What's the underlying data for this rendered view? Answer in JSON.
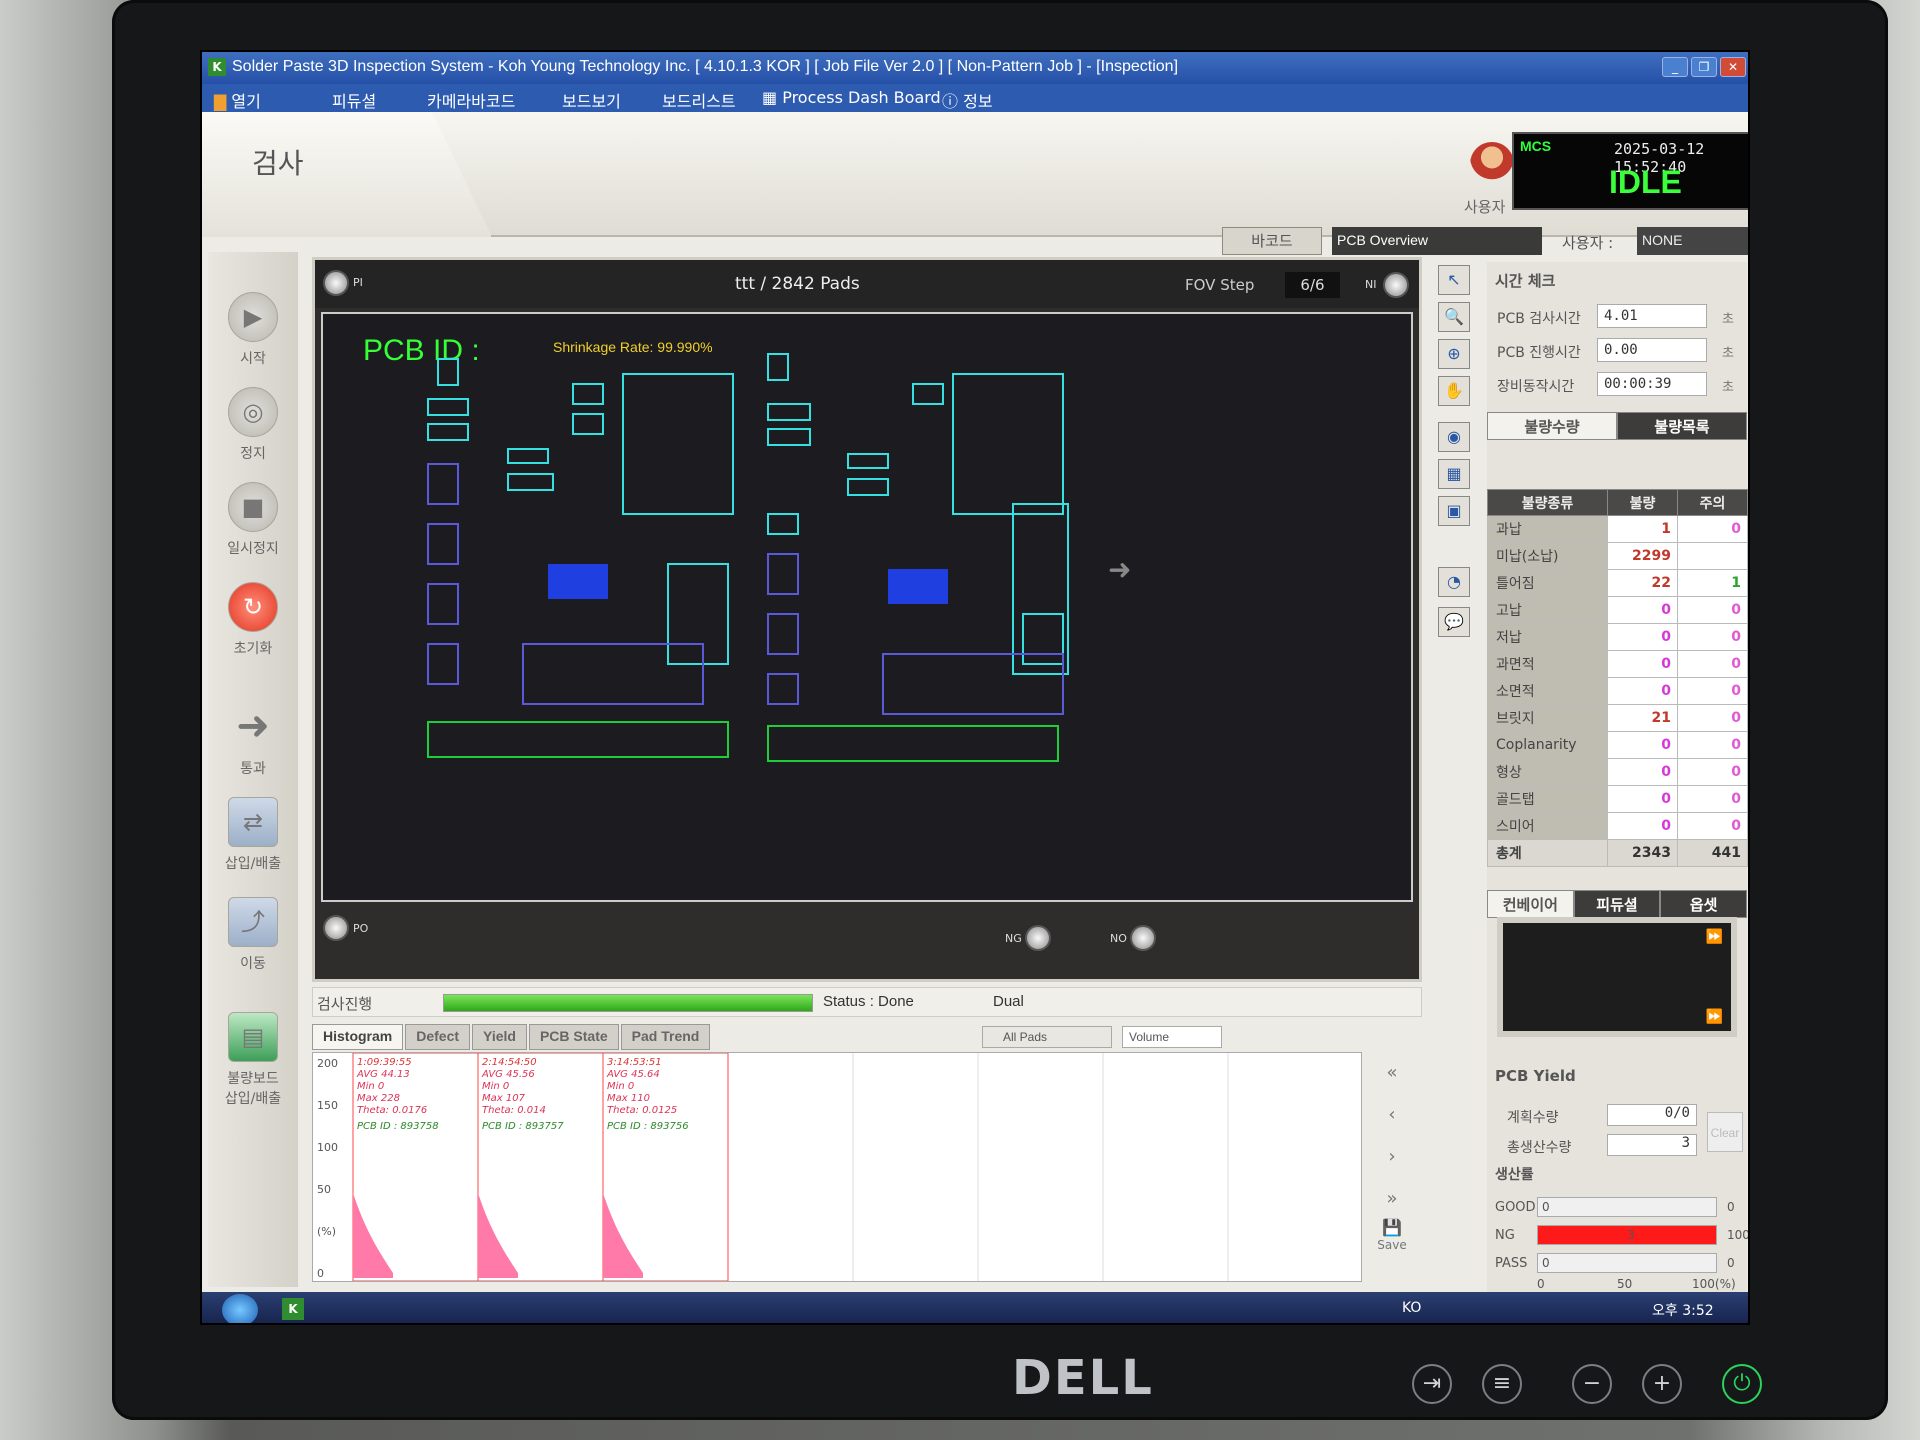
{
  "window": {
    "title": "Solder Paste 3D Inspection System - Koh Young Technology Inc. [ 4.10.1.3 KOR ] [ Job File Ver 2.0 ] [ Non-Pattern Job ] - [Inspection]"
  },
  "menu": [
    "열기",
    "피듀셜",
    "카메라바코드",
    "보드보기",
    "보드리스트",
    "Process Dash Board",
    "정보"
  ],
  "tab": {
    "label": "검사"
  },
  "user": {
    "label": "사용자"
  },
  "mcs": {
    "tag": "MCS",
    "datetime": "2025-03-12  15:52:40",
    "status": "IDLE"
  },
  "header": {
    "barcode": "바코드",
    "overview": "PCB Overview",
    "user_label": "사용자 :",
    "user_value": "NONE"
  },
  "toolbar": [
    {
      "label": "시작",
      "icon": "play-icon"
    },
    {
      "label": "정지",
      "icon": "stop-icon"
    },
    {
      "label": "일시정지",
      "icon": "pause-icon"
    },
    {
      "label": "초기화",
      "icon": "reset-icon"
    },
    {
      "label": "통과",
      "icon": "pass-arrow-icon"
    },
    {
      "label": "삽입/배출",
      "icon": "insert-eject-icon"
    },
    {
      "label": "이동",
      "icon": "move-icon"
    },
    {
      "label": "불량보드\n삽입/배출",
      "icon": "ng-board-icon"
    }
  ],
  "viewer": {
    "title": "ttt / 2842 Pads",
    "fov_label": "FOV Step",
    "fov_value": "6/6",
    "pcb_id": "PCB ID :",
    "shrink": "Shrinkage Rate: 99.990%",
    "knobs": {
      "pi": "PI",
      "ni": "NI",
      "po": "PO",
      "ng": "NG",
      "no": "NO"
    }
  },
  "timecheck": {
    "title": "시간 체크",
    "rows": [
      {
        "label": "PCB 검사시간",
        "value": "4.01",
        "unit": "초"
      },
      {
        "label": "PCB 진행시간",
        "value": "0.00",
        "unit": "초"
      },
      {
        "label": "장비동작시간",
        "value": "00:00:39",
        "unit": "초"
      }
    ]
  },
  "defect_tabs": [
    "불량수량",
    "불량목록"
  ],
  "defect_table": {
    "headers": [
      "불량종류",
      "불량",
      "주의"
    ],
    "rows": [
      {
        "name": "과납",
        "ng": "1",
        "warn": "0"
      },
      {
        "name": "미납(소납)",
        "ng": "2299",
        "warn": ""
      },
      {
        "name": "틀어짐",
        "ng": "22",
        "warn": "1"
      },
      {
        "name": "고납",
        "ng": "0",
        "warn": "0"
      },
      {
        "name": "저납",
        "ng": "0",
        "warn": "0"
      },
      {
        "name": "과면적",
        "ng": "0",
        "warn": "0"
      },
      {
        "name": "소면적",
        "ng": "0",
        "warn": "0"
      },
      {
        "name": "브릿지",
        "ng": "21",
        "warn": "0"
      },
      {
        "name": "Coplanarity",
        "ng": "0",
        "warn": "0"
      },
      {
        "name": "형상",
        "ng": "0",
        "warn": "0"
      },
      {
        "name": "골드탭",
        "ng": "0",
        "warn": "0"
      },
      {
        "name": "스미어",
        "ng": "0",
        "warn": "0"
      }
    ],
    "total": {
      "name": "총계",
      "ng": "2343",
      "warn": "441"
    }
  },
  "bottom_tabs": [
    "컨베이어",
    "피듀셜",
    "옵셋"
  ],
  "yield": {
    "title": "PCB Yield",
    "plan_label": "계획수량",
    "plan_value": "0/0",
    "total_label": "총생산수량",
    "total_value": "3",
    "clear": "Clear",
    "prod_title": "생산률",
    "bars": [
      {
        "label": "GOOD",
        "count": "0",
        "right": "0",
        "pct": 0
      },
      {
        "label": "NG",
        "count": "3",
        "right": "100",
        "pct": 100
      },
      {
        "label": "PASS",
        "count": "0",
        "right": "0",
        "pct": 0
      }
    ],
    "axis": [
      "0",
      "50",
      "100(%)"
    ]
  },
  "progress": {
    "label": "검사진행",
    "status": "Status : Done",
    "mode": "Dual",
    "pct": 100
  },
  "histogram": {
    "tabs": [
      "Histogram",
      "Defect",
      "Yield",
      "PCB State",
      "Pad Trend"
    ],
    "filter": "All Pads",
    "metric": "Volume",
    "yaxis": [
      "200",
      "150",
      "100",
      "50",
      "(%)",
      "0"
    ],
    "boards": [
      {
        "time": "1:09:39:55",
        "avg": "AVG 44.13",
        "min": "Min 0",
        "max": "Max 228",
        "theta": "Theta: 0.0176",
        "id": "PCB ID : 893758"
      },
      {
        "time": "2:14:54:50",
        "avg": "AVG 45.56",
        "min": "Min 0",
        "max": "Max 107",
        "theta": "Theta: 0.014",
        "id": "PCB ID : 893757"
      },
      {
        "time": "3:14:53:51",
        "avg": "AVG 45.64",
        "min": "Min 0",
        "max": "Max 110",
        "theta": "Theta: 0.0125",
        "id": "PCB ID : 893756"
      }
    ],
    "save": "Save"
  },
  "taskbar": {
    "clock": "오후 3:52",
    "tray": "KO"
  },
  "monitor": {
    "brand": "DELL"
  }
}
